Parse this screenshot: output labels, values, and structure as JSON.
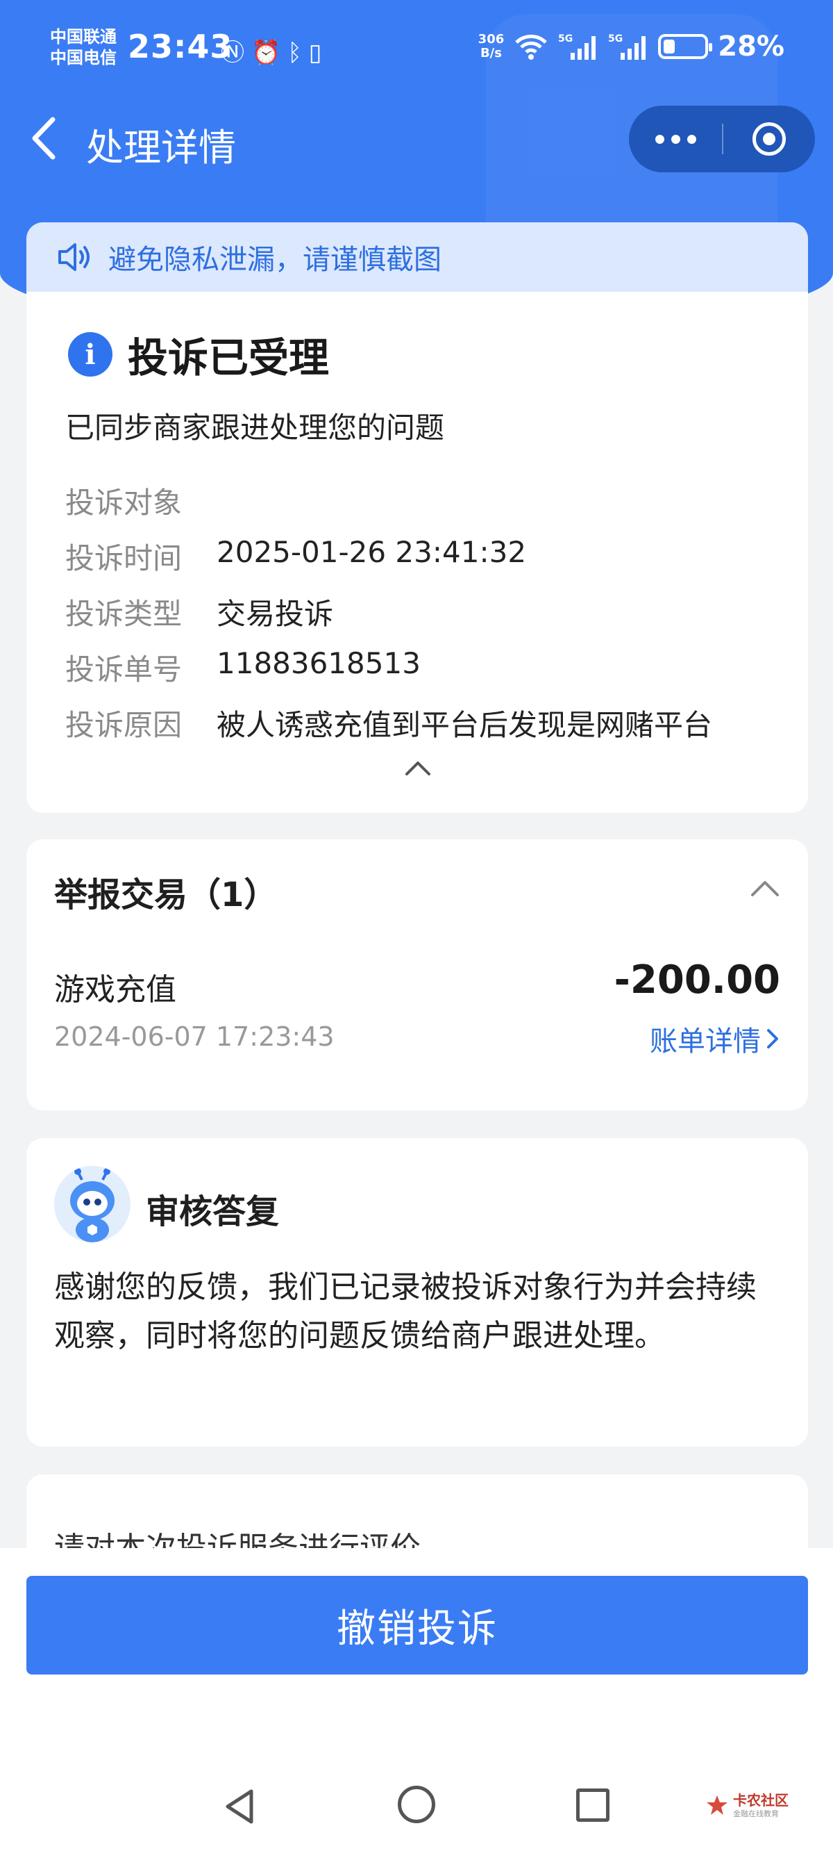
{
  "status_bar": {
    "carrier1": "中国联通",
    "carrier2": "中国电信",
    "time": "23:43",
    "net_speed_value": "306",
    "net_speed_unit": "B/s",
    "battery_percent": "28%",
    "battery_level": 0.28
  },
  "nav": {
    "title": "处理详情"
  },
  "privacy_notice": "避免隐私泄漏，请谨慎截图",
  "complaint": {
    "status_title": "投诉已受理",
    "status_desc": "已同步商家跟进处理您的问题",
    "fields": [
      {
        "label": "投诉对象",
        "value": ""
      },
      {
        "label": "投诉时间",
        "value": "2025-01-26 23:41:32"
      },
      {
        "label": "投诉类型",
        "value": "交易投诉"
      },
      {
        "label": "投诉单号",
        "value": "11883618513"
      },
      {
        "label": "投诉原因",
        "value": "被人诱惑充值到平台后发现是网赌平台"
      }
    ]
  },
  "report": {
    "title": "举报交易（1）",
    "item_name": "游戏充值",
    "amount": "-200.00",
    "time": "2024-06-07 17:23:43",
    "bill_link": "账单详情"
  },
  "reply": {
    "title": "审核答复",
    "text": "感谢您的反馈，我们已记录被投诉对象行为并会持续观察，同时将您的问题反馈给商户跟进处理。"
  },
  "rating": {
    "prompt": "请对本次投诉服务进行评价"
  },
  "action": {
    "revoke_label": "撤销投诉"
  },
  "watermark": {
    "name": "卡农社区",
    "sub": "金融在线教育"
  },
  "colors": {
    "primary": "#3a7cf3",
    "link": "#2e6fe0",
    "notice_bg": "#dce8fd"
  }
}
